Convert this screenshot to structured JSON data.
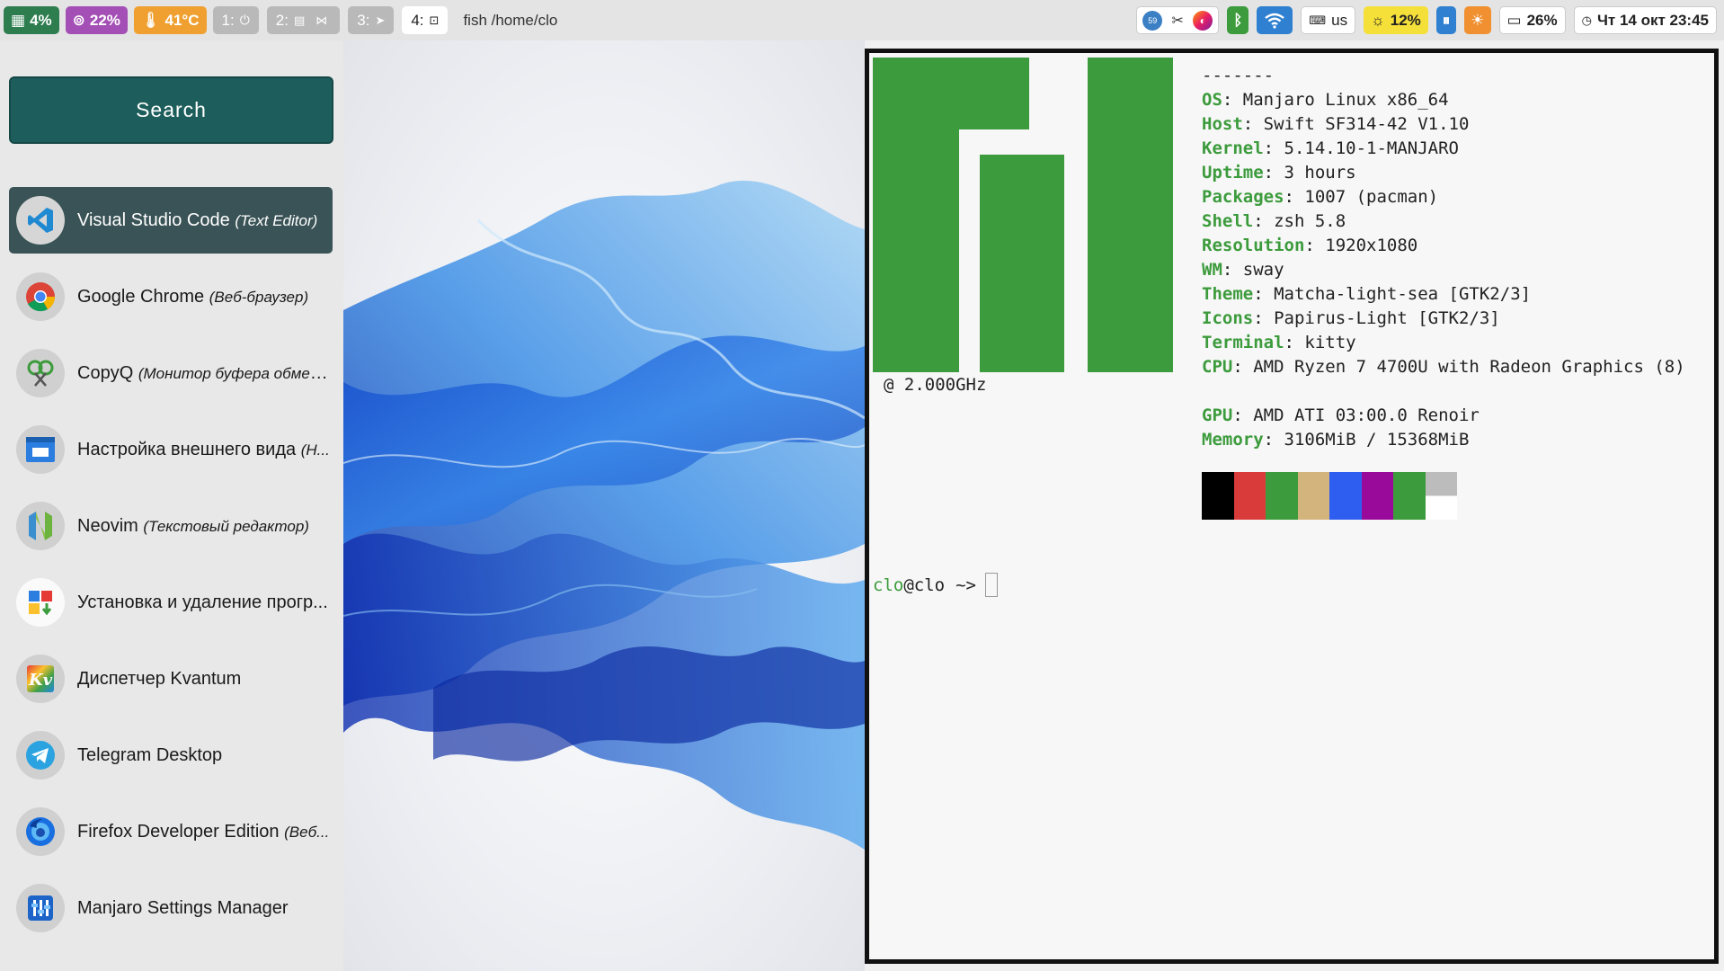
{
  "topbar": {
    "cpu": "4%",
    "mem": "22%",
    "temp": "41°C",
    "workspaces": [
      {
        "label": "1:"
      },
      {
        "label": "2:"
      },
      {
        "label": "3:"
      },
      {
        "label": "4:"
      }
    ],
    "window_title": "fish /home/clo",
    "keyboard_layout": "us",
    "brightness": "12%",
    "battery": "26%",
    "clock": "Чт 14 окт 23:45",
    "tray_badge": "59",
    "colors": {
      "cpu": "#2e7d4f",
      "mem": "#a44fb5",
      "temp": "#f0a030",
      "brightness": "#f5e03a",
      "idle": "#2f80d0",
      "sun": "#f09030"
    }
  },
  "launcher": {
    "search_label": "Search",
    "apps": [
      {
        "name": "Visual Studio Code",
        "desc": "(Text Editor)",
        "icon": "vscode-icon"
      },
      {
        "name": "Google Chrome",
        "desc": "(Веб-браузер)",
        "icon": "chrome-icon"
      },
      {
        "name": "CopyQ",
        "desc": "(Монитор буфера обмена)",
        "icon": "copyq-icon"
      },
      {
        "name": "Настройка внешнего вида",
        "desc": "(Н...",
        "icon": "appearance-icon"
      },
      {
        "name": "Neovim",
        "desc": "(Текстовый редактор)",
        "icon": "neovim-icon"
      },
      {
        "name": "Установка и удаление прогр...",
        "desc": "",
        "icon": "package-manager-icon"
      },
      {
        "name": "Диспетчер Kvantum",
        "desc": "",
        "icon": "kvantum-icon"
      },
      {
        "name": "Telegram Desktop",
        "desc": "",
        "icon": "telegram-icon"
      },
      {
        "name": "Firefox Developer Edition",
        "desc": "(Веб...",
        "icon": "firefox-icon"
      },
      {
        "name": "Manjaro Settings Manager",
        "desc": "",
        "icon": "manjaro-settings-icon"
      }
    ]
  },
  "terminal": {
    "separator": "-------",
    "info": [
      {
        "key": "OS",
        "value": "Manjaro Linux x86_64"
      },
      {
        "key": "Host",
        "value": "Swift SF314-42 V1.10"
      },
      {
        "key": "Kernel",
        "value": "5.14.10-1-MANJARO"
      },
      {
        "key": "Uptime",
        "value": "3 hours"
      },
      {
        "key": "Packages",
        "value": "1007 (pacman)"
      },
      {
        "key": "Shell",
        "value": "zsh 5.8"
      },
      {
        "key": "Resolution",
        "value": "1920x1080"
      },
      {
        "key": "WM",
        "value": "sway"
      },
      {
        "key": "Theme",
        "value": "Matcha-light-sea [GTK2/3]"
      },
      {
        "key": "Icons",
        "value": "Papirus-Light [GTK2/3]"
      },
      {
        "key": "Terminal",
        "value": "kitty"
      },
      {
        "key": "CPU",
        "value": "AMD Ryzen 7 4700U with Radeon Graphics (8)"
      },
      {
        "key": "GPU",
        "value": "AMD ATI 03:00.0 Renoir"
      },
      {
        "key": "Memory",
        "value": "3106MiB / 15368MiB"
      }
    ],
    "cpu_tail": " @ 2.000GHz",
    "palette_top": [
      "#000000",
      "#d93b3b",
      "#3c9b3c",
      "#d2b47c",
      "#2e5ef0",
      "#9a0a9a",
      "#3c9b3c",
      "#bcbcbc"
    ],
    "palette_bottom": [
      "#000000",
      "#d93b3b",
      "#3c9b3c",
      "#d2b47c",
      "#2e5ef0",
      "#9a0a9a",
      "#3c9b3c",
      "#ffffff"
    ],
    "prompt_user": "clo",
    "prompt_at": "@clo",
    "prompt_arrow": "~>",
    "logo_color": "#3c9b3c"
  }
}
